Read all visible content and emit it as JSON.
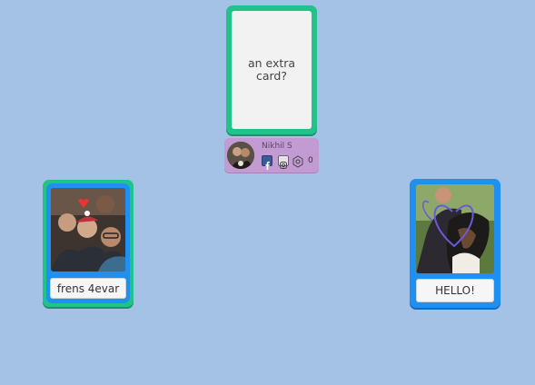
{
  "center_card": {
    "text": "an extra card?"
  },
  "profile": {
    "name": "Nikhil S",
    "stat_count": "0"
  },
  "left_card": {
    "caption": "frens 4evar"
  },
  "right_card": {
    "caption": "HELLO!"
  },
  "icons": [
    "facebook-icon",
    "instagram-icon",
    "stat-icon"
  ],
  "colors": {
    "background": "#a3c2e6",
    "green_card": "#22c28b",
    "blue_card": "#1f8ff0",
    "profile": "#c29bd3"
  }
}
